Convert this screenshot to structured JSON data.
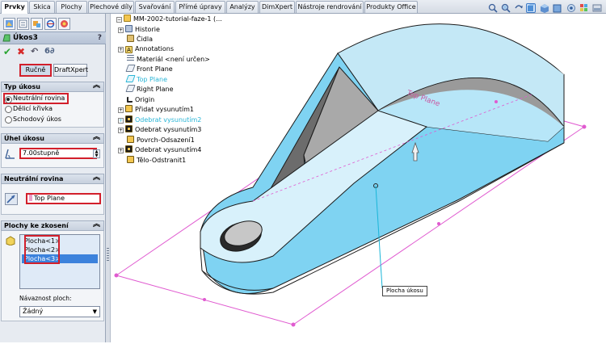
{
  "tabs": [
    {
      "label": "Prvky",
      "active": true
    },
    {
      "label": "Skica"
    },
    {
      "label": "Plochy"
    },
    {
      "label": "Plechové díly"
    },
    {
      "label": "Svařování"
    },
    {
      "label": "Přímé úpravy"
    },
    {
      "label": "Analýzy"
    },
    {
      "label": "DimXpert"
    },
    {
      "label": "Nástroje rendrování"
    },
    {
      "label": "Produkty Office"
    }
  ],
  "property_manager": {
    "title": "Úkos3",
    "help": "?",
    "buttons": {
      "manual": "Ručně",
      "draftxpert": "DraftXpert"
    },
    "draft_type": {
      "header": "Typ úkosu",
      "options": [
        "Neutrální rovina",
        "Dělicí křivka",
        "Schodový úkos"
      ],
      "selected": "Neutrální rovina"
    },
    "draft_angle": {
      "header": "Úhel úkosu",
      "value": "7.00stupně"
    },
    "neutral_plane": {
      "header": "Neutrální rovina",
      "value": "Top Plane"
    },
    "faces": {
      "header": "Plochy ke zkosení",
      "items": [
        "Plocha<1>",
        "Plocha<2>",
        "Plocha<3>"
      ],
      "highlighted": "Plocha<3>",
      "propagation_label": "Návaznost ploch:",
      "propagation_value": "Žádný"
    }
  },
  "feature_tree": {
    "root": "MM-2002-tutorial-faze-1 (...",
    "items": [
      {
        "label": "Historie",
        "icon": "history-icon"
      },
      {
        "label": "Čidla",
        "icon": "sensor-icon"
      },
      {
        "label": "Annotations",
        "icon": "annotation-icon"
      },
      {
        "label": "Materiál <není určen>",
        "icon": "material-icon"
      },
      {
        "label": "Front Plane",
        "icon": "plane-icon"
      },
      {
        "label": "Top Plane",
        "icon": "plane-icon",
        "highlight": true
      },
      {
        "label": "Right Plane",
        "icon": "plane-icon"
      },
      {
        "label": "Origin",
        "icon": "origin-icon"
      },
      {
        "label": "Přidat vysunutím1",
        "icon": "extrude-icon"
      },
      {
        "label": "Odebrat vysunutím2",
        "icon": "cut-icon",
        "highlight": true
      },
      {
        "label": "Odebrat vysunutím3",
        "icon": "cut-icon"
      },
      {
        "label": "Povrch-Odsazení1",
        "icon": "surface-icon"
      },
      {
        "label": "Odebrat vysunutím4",
        "icon": "cut-icon"
      },
      {
        "label": "Tělo-Odstranit1",
        "icon": "delete-body-icon"
      }
    ]
  },
  "viewport": {
    "tooltip": "Plocha úkosu",
    "plane_label": "Top Plane",
    "accent": "#5bc8f0",
    "plane_color": "#e05ad0"
  }
}
